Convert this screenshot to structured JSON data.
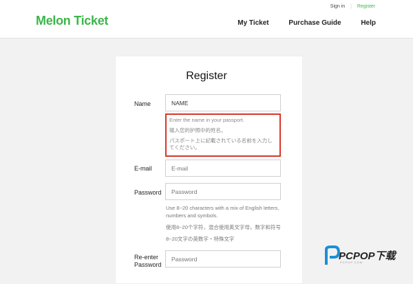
{
  "header": {
    "logo_text": "Melon Ticket",
    "util_links": [
      "Sign in",
      "Register"
    ],
    "nav": [
      "My Ticket",
      "Purchase Guide",
      "Help"
    ]
  },
  "form": {
    "title": "Register",
    "name_label": "Name",
    "name_value": "NAME",
    "name_hints": [
      "Enter the name in your passport.",
      "输入您的护照中的姓名。",
      "パスポート上に記載されている名前を入力してください。"
    ],
    "email_label": "E-mail",
    "email_placeholder": "E-mail",
    "password_label": "Password",
    "password_placeholder": "Password",
    "password_hints": [
      "Use 8~20 characters with a mix of English letters, numbers and symbols.",
      "使用8~20个字符，混合使用英文字母，数字和符号",
      "8~20文字の英数字・特殊文字"
    ],
    "reenter_label_line1": "Re-enter",
    "reenter_label_line2": "Password",
    "reenter_placeholder": "Password"
  },
  "watermark": {
    "text": "PCPOP下载",
    "sub": "PCPOP.COM"
  },
  "colors": {
    "brand_green": "#3cb54a",
    "highlight_red": "#d9342b"
  }
}
